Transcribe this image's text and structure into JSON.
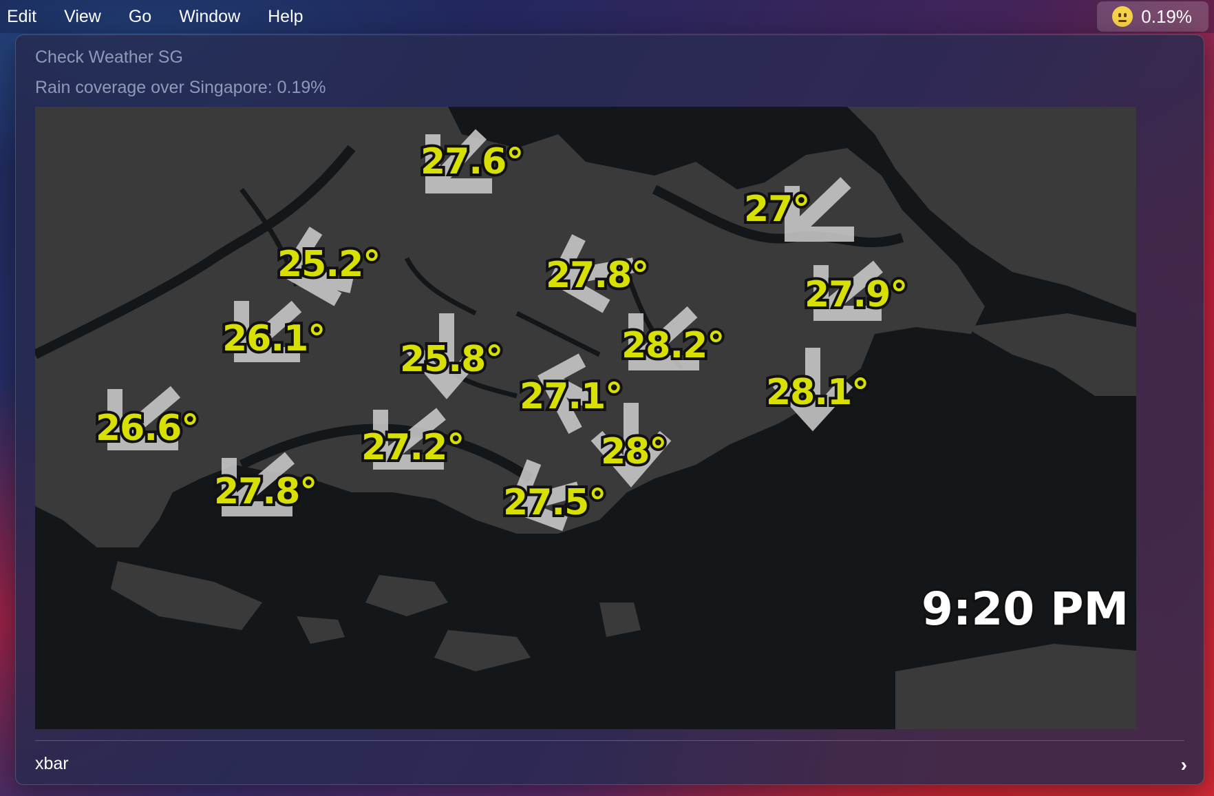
{
  "menubar": {
    "items": [
      "Edit",
      "View",
      "Go",
      "Window",
      "Help"
    ],
    "status_value": "0.19%",
    "status_icon": "slight-smile-emoji-icon"
  },
  "panel": {
    "title": "Check Weather SG",
    "subtitle": "Rain coverage over Singapore: 0.19%",
    "footer_label": "xbar",
    "footer_icon": "chevron-right-icon"
  },
  "map": {
    "time": "9:20 PM",
    "readings": [
      {
        "temp": "27.6°",
        "wind": "from-northeast"
      },
      {
        "temp": "27°",
        "wind": "from-northeast"
      },
      {
        "temp": "25.2°",
        "wind": "from-north-northwest"
      },
      {
        "temp": "27.8°",
        "wind": "from-northwest"
      },
      {
        "temp": "27.9°",
        "wind": "from-northeast"
      },
      {
        "temp": "26.1°",
        "wind": "from-northeast"
      },
      {
        "temp": "28.2°",
        "wind": "from-northeast"
      },
      {
        "temp": "25.8°",
        "wind": "from-north"
      },
      {
        "temp": "28.1°",
        "wind": "from-north"
      },
      {
        "temp": "27.1°",
        "wind": "from-east-northeast"
      },
      {
        "temp": "26.6°",
        "wind": "from-northeast"
      },
      {
        "temp": "27.2°",
        "wind": "from-northeast"
      },
      {
        "temp": "28°",
        "wind": "from-north"
      },
      {
        "temp": "27.8°",
        "wind": "from-northeast"
      },
      {
        "temp": "27.5°",
        "wind": "from-north-northwest"
      }
    ],
    "colors": {
      "sea": "#141719",
      "land": "#3a3a3a",
      "label": "#d7e000",
      "arrow": "#cfcfcf"
    }
  }
}
